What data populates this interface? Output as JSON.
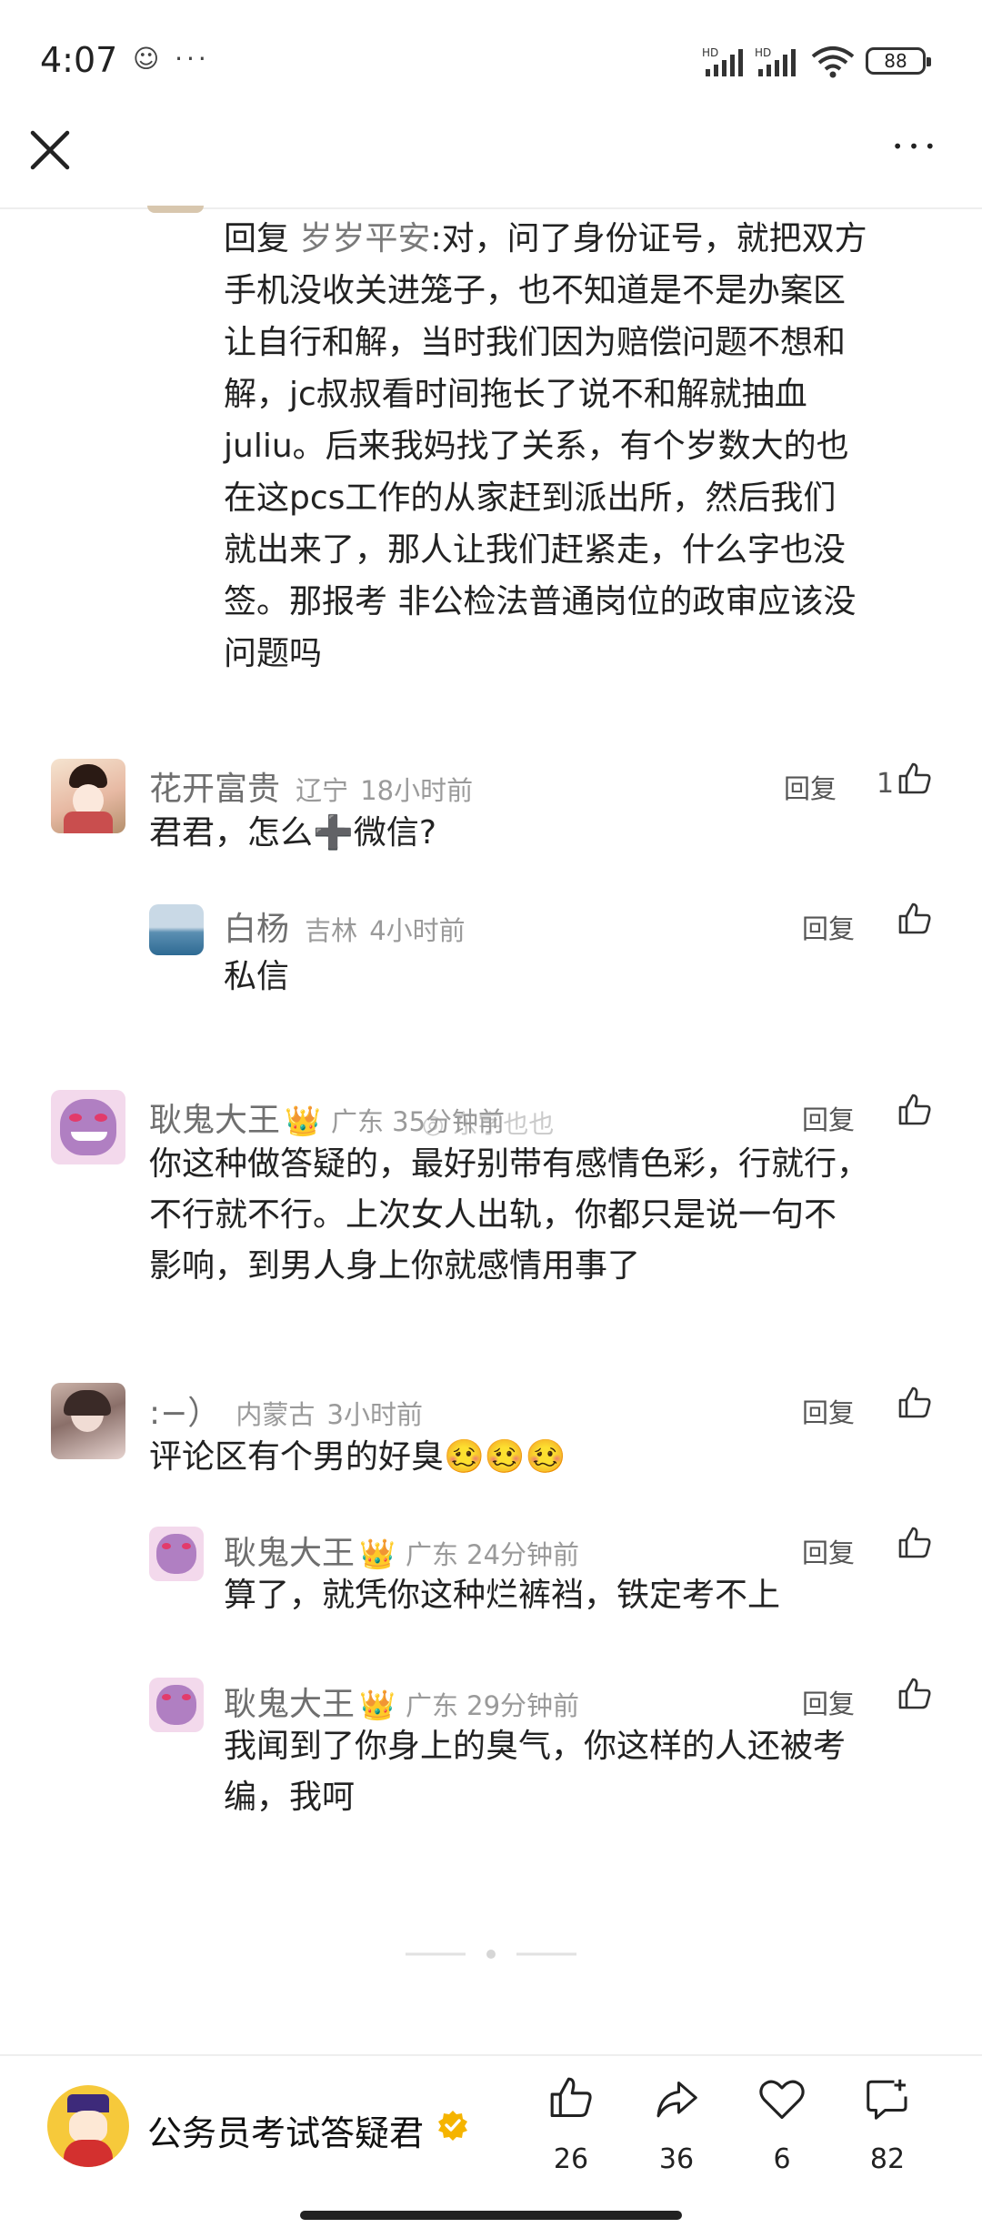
{
  "status_bar": {
    "time": "4:07",
    "left_icons": "☺ ···",
    "signal1_label": "HD",
    "signal2_label": "HD",
    "battery": "88"
  },
  "header": {
    "close_icon": "close-icon",
    "more_icon": "more-icon",
    "more_glyph": "•••"
  },
  "top_reply": {
    "prefix": "回复",
    "mention": "岁岁平安",
    "lines": [
      ":对，问了身份证号，就把双方",
      "手机没收关进笼子，也不知道是不是办案区",
      "让自行和解，当时我们因为赔偿问题不想和",
      "解，jc叔叔看时间拖长了说不和解就抽血",
      "juliu。后来我妈找了关系，有个岁数大的也",
      "在这pcs工作的从家赶到派出所，然后我们",
      "就出来了，那人让我们赶紧走，什么字也没",
      "签。那报考 非公检法普通岗位的政审应该没",
      "问题吗"
    ]
  },
  "comments": [
    {
      "name": "花开富贵",
      "location": "辽宁",
      "time": "18小时前",
      "reply_label": "回复",
      "likes": "1",
      "text": "君君，怎么➕微信?",
      "replies": [
        {
          "name": "白杨",
          "location": "吉林",
          "time": "4小时前",
          "reply_label": "回复",
          "text": "私信"
        }
      ]
    },
    {
      "name": "耿鬼大王",
      "crown": "👑",
      "location": "广东",
      "time": "35分钟前",
      "reply_label": "回复",
      "watermark": "东字也也",
      "lines": [
        "你这种做答疑的，最好别带有感情色彩，行就行，",
        "不行就不行。上次女人出轨，你都只是说一句不",
        "影响，到男人身上你就感情用事了"
      ]
    },
    {
      "name": ":−）",
      "location": "内蒙古",
      "time": "3小时前",
      "reply_label": "回复",
      "text": "评论区有个男的好臭",
      "emojis": "🥴🥴🥴",
      "replies": [
        {
          "name": "耿鬼大王",
          "crown": "👑",
          "location": "广东",
          "time": "24分钟前",
          "reply_label": "回复",
          "lines": [
            "算了，就凭你这种烂裤裆，铁定考不上"
          ]
        },
        {
          "name": "耿鬼大王",
          "crown": "👑",
          "location": "广东",
          "time": "29分钟前",
          "reply_label": "回复",
          "lines": [
            "我闻到了你身上的臭气，你这样的人还被考",
            "编，我呵"
          ]
        }
      ]
    }
  ],
  "bottom_bar": {
    "author": "公务员考试答疑君",
    "verified_icon": "verified-icon",
    "actions": [
      {
        "icon": "like-icon",
        "count": "26"
      },
      {
        "icon": "share-icon",
        "count": "36"
      },
      {
        "icon": "heart-icon",
        "count": "6"
      },
      {
        "icon": "comment-icon",
        "count": "82"
      }
    ]
  },
  "colors": {
    "text": "#222222",
    "meta": "#9a9a9a",
    "name": "#6f6f6f",
    "crown": "#e8b21c",
    "verified": "#f5b400"
  }
}
